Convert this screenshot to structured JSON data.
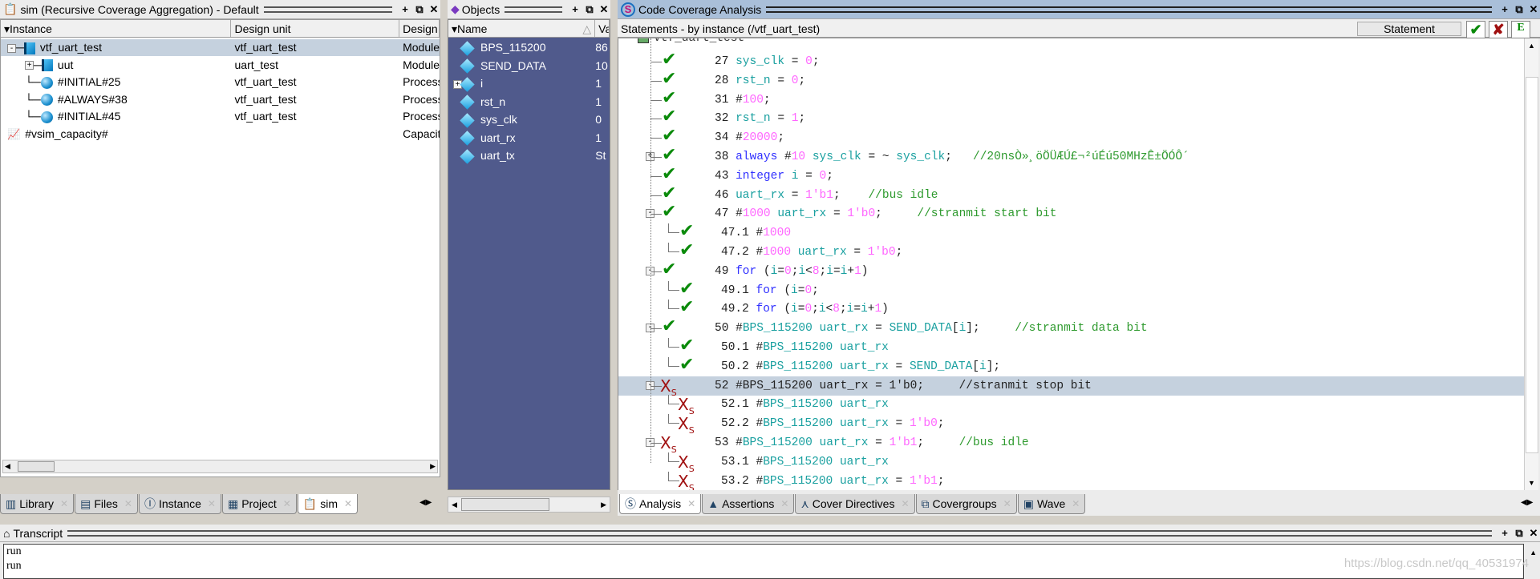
{
  "sim": {
    "title": "sim (Recursive Coverage Aggregation) - Default",
    "columns": [
      "Instance",
      "Design unit",
      "Design"
    ],
    "rows": [
      {
        "name": "vtf_uart_test",
        "unit": "vtf_uart_test",
        "type": "Module",
        "icon": "module-icon",
        "toggle": "-",
        "level": 0,
        "selected": true
      },
      {
        "name": "uut",
        "unit": "uart_test",
        "type": "Module",
        "icon": "module-icon",
        "toggle": "+",
        "level": 1
      },
      {
        "name": "#INITIAL#25",
        "unit": "vtf_uart_test",
        "type": "Process",
        "icon": "process-icon",
        "level": 1
      },
      {
        "name": "#ALWAYS#38",
        "unit": "vtf_uart_test",
        "type": "Process",
        "icon": "process-icon",
        "level": 1
      },
      {
        "name": "#INITIAL#45",
        "unit": "vtf_uart_test",
        "type": "Process",
        "icon": "process-icon",
        "level": 1
      },
      {
        "name": "#vsim_capacity#",
        "unit": "",
        "type": "Capacit",
        "icon": "capacity-icon",
        "level": 0
      }
    ],
    "tabs": [
      {
        "label": "Library",
        "icon": "library-icon"
      },
      {
        "label": "Files",
        "icon": "files-icon"
      },
      {
        "label": "Instance",
        "icon": "instance-icon"
      },
      {
        "label": "Project",
        "icon": "project-icon"
      },
      {
        "label": "sim",
        "icon": "sim-icon",
        "active": true
      }
    ]
  },
  "objects": {
    "title": "Objects",
    "columns": [
      "Name",
      "Va"
    ],
    "rows": [
      {
        "name": "BPS_115200",
        "value": "86"
      },
      {
        "name": "SEND_DATA",
        "value": "10"
      },
      {
        "name": "i",
        "value": "1",
        "toggle": "+"
      },
      {
        "name": "rst_n",
        "value": "1"
      },
      {
        "name": "sys_clk",
        "value": "0"
      },
      {
        "name": "uart_rx",
        "value": "1"
      },
      {
        "name": "uart_tx",
        "value": "St"
      }
    ]
  },
  "coverage": {
    "title": "Code Coverage Analysis",
    "subtitle": "Statements - by instance (/vtf_uart_test)",
    "mode": "Statement",
    "top_item": "vtf_uart_test",
    "lines": [
      {
        "status": "hit",
        "level": 0,
        "seg": [
          [
            "27 ",
            "t"
          ],
          [
            "sys_clk",
            "id"
          ],
          [
            " = ",
            "t"
          ],
          [
            "0",
            "num"
          ],
          [
            ";",
            "t"
          ]
        ]
      },
      {
        "status": "hit",
        "level": 0,
        "seg": [
          [
            "28 ",
            "t"
          ],
          [
            "rst_n",
            "id"
          ],
          [
            " = ",
            "t"
          ],
          [
            "0",
            "num"
          ],
          [
            ";",
            "t"
          ]
        ]
      },
      {
        "status": "hit",
        "level": 0,
        "seg": [
          [
            "31 #",
            "t"
          ],
          [
            "100",
            "num"
          ],
          [
            ";",
            "t"
          ]
        ]
      },
      {
        "status": "hit",
        "level": 0,
        "seg": [
          [
            "32 ",
            "t"
          ],
          [
            "rst_n",
            "id"
          ],
          [
            " = ",
            "t"
          ],
          [
            "1",
            "num"
          ],
          [
            ";",
            "t"
          ]
        ]
      },
      {
        "status": "hit",
        "level": 0,
        "seg": [
          [
            "34 #",
            "t"
          ],
          [
            "20000",
            "num"
          ],
          [
            ";",
            "t"
          ]
        ]
      },
      {
        "status": "hit",
        "level": 0,
        "toggle": "+",
        "seg": [
          [
            "38 ",
            "t"
          ],
          [
            "always",
            "kw"
          ],
          [
            " #",
            "t"
          ],
          [
            "10",
            "num"
          ],
          [
            " ",
            "t"
          ],
          [
            "sys_clk",
            "id"
          ],
          [
            " = ~ ",
            "t"
          ],
          [
            "sys_clk",
            "id"
          ],
          [
            ";   ",
            "t"
          ],
          [
            "//20nsÒ»¸öÖÜÆÚ£¬²úÉú50MHzÊ±ÖÓÔ´",
            "cm"
          ]
        ]
      },
      {
        "status": "hit",
        "level": 0,
        "seg": [
          [
            "43 ",
            "t"
          ],
          [
            "integer",
            "kw"
          ],
          [
            " ",
            "t"
          ],
          [
            "i",
            "id"
          ],
          [
            " = ",
            "t"
          ],
          [
            "0",
            "num"
          ],
          [
            ";",
            "t"
          ]
        ]
      },
      {
        "status": "hit",
        "level": 0,
        "seg": [
          [
            "46 ",
            "t"
          ],
          [
            "uart_rx",
            "id"
          ],
          [
            " = ",
            "t"
          ],
          [
            "1'b1",
            "num"
          ],
          [
            ";    ",
            "t"
          ],
          [
            "//bus idle",
            "cm"
          ]
        ]
      },
      {
        "status": "hit",
        "level": 0,
        "toggle": "-",
        "seg": [
          [
            "47 #",
            "t"
          ],
          [
            "1000",
            "num"
          ],
          [
            " ",
            "t"
          ],
          [
            "uart_rx",
            "id"
          ],
          [
            " = ",
            "t"
          ],
          [
            "1'b0",
            "num"
          ],
          [
            ";     ",
            "t"
          ],
          [
            "//stranmit start bit",
            "cm"
          ]
        ]
      },
      {
        "status": "hit",
        "level": 1,
        "seg": [
          [
            "47.1 #",
            "t"
          ],
          [
            "1000",
            "num"
          ]
        ]
      },
      {
        "status": "hit",
        "level": 1,
        "last": true,
        "seg": [
          [
            "47.2 #",
            "t"
          ],
          [
            "1000",
            "num"
          ],
          [
            " ",
            "t"
          ],
          [
            "uart_rx",
            "id"
          ],
          [
            " = ",
            "t"
          ],
          [
            "1'b0",
            "num"
          ],
          [
            ";",
            "t"
          ]
        ]
      },
      {
        "status": "hit",
        "level": 0,
        "toggle": "-",
        "seg": [
          [
            "49 ",
            "t"
          ],
          [
            "for",
            "kw"
          ],
          [
            " (",
            "t"
          ],
          [
            "i",
            "id"
          ],
          [
            "=",
            "t"
          ],
          [
            "0",
            "num"
          ],
          [
            ";",
            "t"
          ],
          [
            "i",
            "id"
          ],
          [
            "<",
            "t"
          ],
          [
            "8",
            "num"
          ],
          [
            ";",
            "t"
          ],
          [
            "i",
            "id"
          ],
          [
            "=",
            "t"
          ],
          [
            "i",
            "id"
          ],
          [
            "+",
            "t"
          ],
          [
            "1",
            "num"
          ],
          [
            ")",
            "t"
          ]
        ]
      },
      {
        "status": "hit",
        "level": 1,
        "seg": [
          [
            "49.1 ",
            "t"
          ],
          [
            "for",
            "kw"
          ],
          [
            " (",
            "t"
          ],
          [
            "i",
            "id"
          ],
          [
            "=",
            "t"
          ],
          [
            "0",
            "num"
          ],
          [
            ";",
            "t"
          ]
        ]
      },
      {
        "status": "hit",
        "level": 1,
        "last": true,
        "seg": [
          [
            "49.2 ",
            "t"
          ],
          [
            "for",
            "kw"
          ],
          [
            " (",
            "t"
          ],
          [
            "i",
            "id"
          ],
          [
            "=",
            "t"
          ],
          [
            "0",
            "num"
          ],
          [
            ";",
            "t"
          ],
          [
            "i",
            "id"
          ],
          [
            "<",
            "t"
          ],
          [
            "8",
            "num"
          ],
          [
            ";",
            "t"
          ],
          [
            "i",
            "id"
          ],
          [
            "=",
            "t"
          ],
          [
            "i",
            "id"
          ],
          [
            "+",
            "t"
          ],
          [
            "1",
            "num"
          ],
          [
            ")",
            "t"
          ]
        ]
      },
      {
        "status": "hit",
        "level": 0,
        "toggle": "-",
        "seg": [
          [
            "50 #",
            "t"
          ],
          [
            "BPS_115200",
            "id"
          ],
          [
            " ",
            "t"
          ],
          [
            "uart_rx",
            "id"
          ],
          [
            " = ",
            "t"
          ],
          [
            "SEND_DATA",
            "id"
          ],
          [
            "[",
            "t"
          ],
          [
            "i",
            "id"
          ],
          [
            "];     ",
            "t"
          ],
          [
            "//stranmit data bit",
            "cm"
          ]
        ]
      },
      {
        "status": "hit",
        "level": 1,
        "seg": [
          [
            "50.1 #",
            "t"
          ],
          [
            "BPS_115200",
            "id"
          ],
          [
            " ",
            "t"
          ],
          [
            "uart_rx",
            "id"
          ]
        ]
      },
      {
        "status": "hit",
        "level": 1,
        "last": true,
        "seg": [
          [
            "50.2 #",
            "t"
          ],
          [
            "BPS_115200",
            "id"
          ],
          [
            " ",
            "t"
          ],
          [
            "uart_rx",
            "id"
          ],
          [
            " = ",
            "t"
          ],
          [
            "SEND_DATA",
            "id"
          ],
          [
            "[",
            "t"
          ],
          [
            "i",
            "id"
          ],
          [
            "];",
            "t"
          ]
        ]
      },
      {
        "status": "miss",
        "level": 0,
        "toggle": "-",
        "selected": true,
        "seg": [
          [
            "52 #BPS_115200 uart_rx = 1'b0;     //stranmit stop bit",
            "t"
          ]
        ]
      },
      {
        "status": "miss",
        "level": 1,
        "seg": [
          [
            "52.1 #",
            "t"
          ],
          [
            "BPS_115200",
            "id"
          ],
          [
            " ",
            "t"
          ],
          [
            "uart_rx",
            "id"
          ]
        ]
      },
      {
        "status": "miss",
        "level": 1,
        "last": true,
        "seg": [
          [
            "52.2 #",
            "t"
          ],
          [
            "BPS_115200",
            "id"
          ],
          [
            " ",
            "t"
          ],
          [
            "uart_rx",
            "id"
          ],
          [
            " = ",
            "t"
          ],
          [
            "1'b0",
            "num"
          ],
          [
            ";",
            "t"
          ]
        ]
      },
      {
        "status": "miss",
        "level": 0,
        "toggle": "-",
        "seg": [
          [
            "53 #",
            "t"
          ],
          [
            "BPS_115200",
            "id"
          ],
          [
            " ",
            "t"
          ],
          [
            "uart_rx",
            "id"
          ],
          [
            " = ",
            "t"
          ],
          [
            "1'b1",
            "num"
          ],
          [
            ";     ",
            "t"
          ],
          [
            "//bus idle",
            "cm"
          ]
        ]
      },
      {
        "status": "miss",
        "level": 1,
        "seg": [
          [
            "53.1 #",
            "t"
          ],
          [
            "BPS_115200",
            "id"
          ],
          [
            " ",
            "t"
          ],
          [
            "uart_rx",
            "id"
          ]
        ]
      },
      {
        "status": "miss",
        "level": 1,
        "last": true,
        "seg": [
          [
            "53.2 #",
            "t"
          ],
          [
            "BPS_115200",
            "id"
          ],
          [
            " ",
            "t"
          ],
          [
            "uart_rx",
            "id"
          ],
          [
            " = ",
            "t"
          ],
          [
            "1'b1",
            "num"
          ],
          [
            ";",
            "t"
          ]
        ]
      }
    ],
    "miss_suffix": "S",
    "tabs": [
      {
        "label": "Analysis",
        "icon": "analysis-icon",
        "active": true
      },
      {
        "label": "Assertions",
        "icon": "assertions-icon"
      },
      {
        "label": "Cover Directives",
        "icon": "cover-directives-icon"
      },
      {
        "label": "Covergroups",
        "icon": "covergroups-icon"
      },
      {
        "label": "Wave",
        "icon": "wave-icon"
      }
    ]
  },
  "transcript": {
    "title": "Transcript",
    "lines": [
      "run",
      "run"
    ]
  },
  "watermark": "https://blog.csdn.net/qq_40531974",
  "colors": {
    "hit": "#0a8a0a",
    "miss": "#a01010",
    "objects_bg": "#505a8c",
    "selection": "#c5d1de"
  }
}
